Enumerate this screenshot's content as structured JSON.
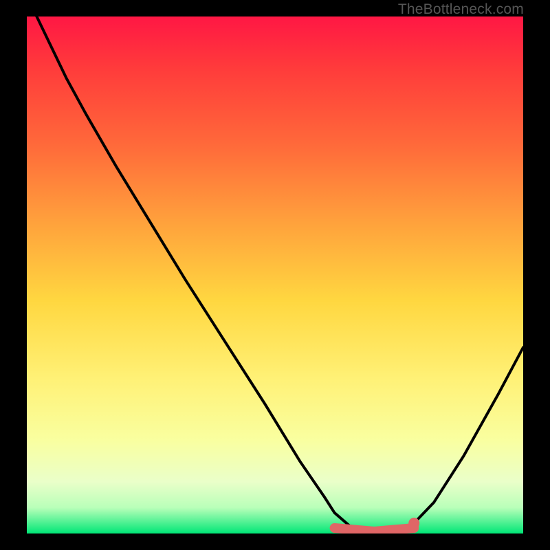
{
  "watermark": "TheBottleneck.com",
  "colors": {
    "background": "#000000",
    "gradient_top": "#ff1744",
    "gradient_bottom": "#00e676",
    "curve": "#000000",
    "marker": "#e06666",
    "watermark_text": "#555555"
  },
  "chart_data": {
    "type": "line",
    "title": "",
    "xlabel": "",
    "ylabel": "",
    "xlim": [
      0,
      100
    ],
    "ylim": [
      0,
      100
    ],
    "x": [
      0,
      2,
      5,
      8,
      12,
      18,
      25,
      32,
      40,
      48,
      55,
      60,
      62,
      65,
      68,
      72,
      75,
      78,
      82,
      88,
      95,
      100
    ],
    "values": [
      105,
      100,
      94,
      88,
      81,
      71,
      60,
      49,
      37,
      25,
      14,
      7,
      4,
      1.5,
      0.8,
      0.6,
      0.8,
      2,
      6,
      15,
      27,
      36
    ],
    "grid": false,
    "legend": false,
    "annotations": [
      "TheBottleneck.com"
    ],
    "optimal_region": {
      "x_start": 62,
      "x_end": 78,
      "y_level": 0.8
    },
    "marker_point": {
      "x": 78,
      "y": 2
    }
  }
}
